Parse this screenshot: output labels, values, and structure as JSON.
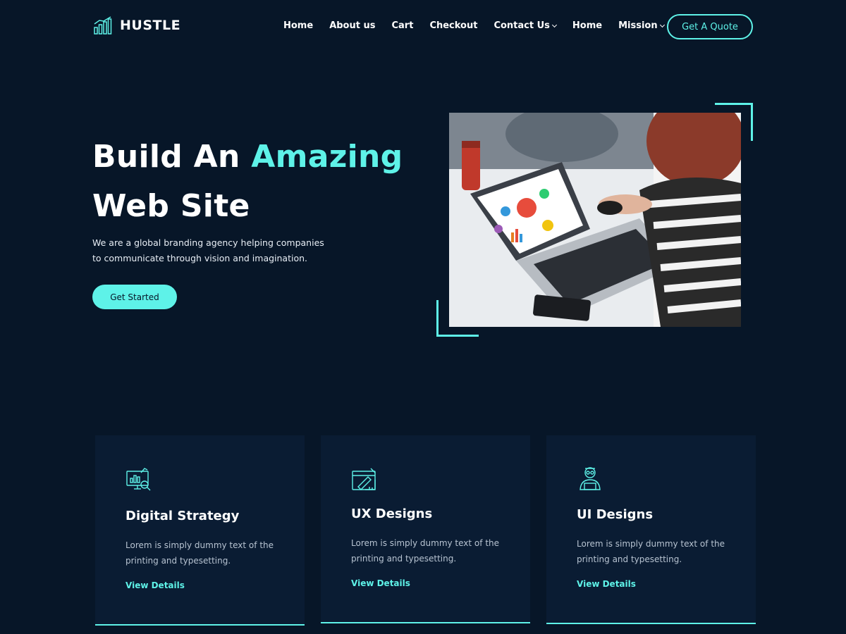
{
  "brand": {
    "name": "HUSTLE",
    "logo_icon": "bar-chart-icon"
  },
  "nav": {
    "items": [
      {
        "label": "Home",
        "dropdown": false
      },
      {
        "label": "About us",
        "dropdown": false
      },
      {
        "label": "Cart",
        "dropdown": false
      },
      {
        "label": "Checkout",
        "dropdown": false
      },
      {
        "label": "Contact Us",
        "dropdown": true
      },
      {
        "label": "Home",
        "dropdown": false
      },
      {
        "label": "Mission",
        "dropdown": true
      }
    ],
    "cta_label": "Get A Quote"
  },
  "hero": {
    "title_part1": "Build An",
    "title_accent": "Amazing",
    "title_line2": "Web Site",
    "description": "We are a global branding agency helping companies to communicate through vision and imagination.",
    "button_label": "Get Started",
    "image_alt": "person working on laptop with charts"
  },
  "cards": [
    {
      "icon": "analytics-monitor-icon",
      "title": "Digital Strategy",
      "text": "Lorem is simply dummy text of the printing and typesetting.",
      "link": "View Details"
    },
    {
      "icon": "design-blueprint-icon",
      "title": "UX Designs",
      "text": "Lorem is simply dummy text of the printing and typesetting.",
      "link": "View Details"
    },
    {
      "icon": "designer-person-icon",
      "title": "UI Designs",
      "text": "Lorem is simply dummy text of the printing and typesetting.",
      "link": "View Details"
    }
  ],
  "colors": {
    "background": "#071628",
    "card_background": "#0a1c33",
    "accent": "#5ef2e8",
    "text": "#ffffff"
  }
}
